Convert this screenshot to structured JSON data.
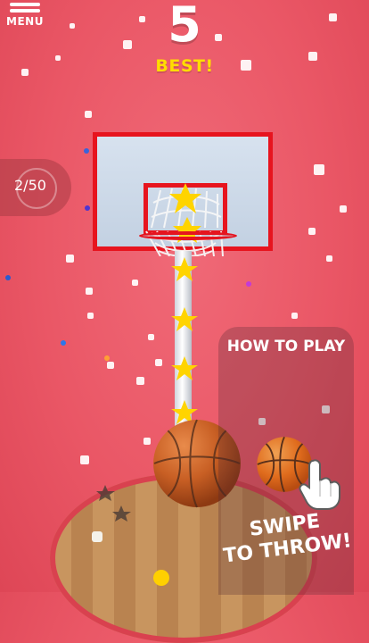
{
  "hud": {
    "menu_label": "MENU",
    "score": "5",
    "best_label": "BEST!"
  },
  "progress": {
    "text": "2/50",
    "fraction": 0.04
  },
  "how_to_play": {
    "title": "HOW TO PLAY",
    "message": "SWIPE\nTO THROW!"
  },
  "colors": {
    "background": "#ea5766",
    "hoop": "#e7141e",
    "best": "#ffdd00",
    "ball": "#c75b1f",
    "star": "#ffd400"
  },
  "icons": [
    "menu-icon",
    "basketball-icon",
    "star-icon",
    "hand-icon"
  ]
}
